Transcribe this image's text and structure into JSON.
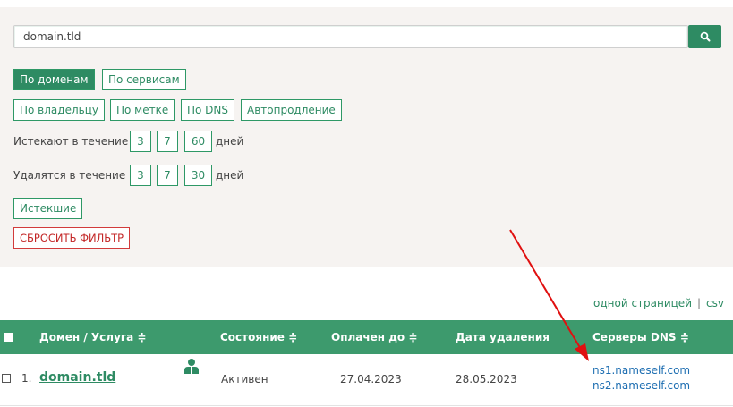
{
  "search": {
    "value": "domain.tld",
    "button_icon": "search-icon"
  },
  "filters": {
    "by_domains": "По доменам",
    "by_services": "По сервисам",
    "by_owner": "По владельцу",
    "by_tag": "По метке",
    "by_dns": "По DNS",
    "autorenew": "Автопродление",
    "expire_label": "Истекают в течение",
    "expire_options": [
      "3",
      "7",
      "60"
    ],
    "delete_label": "Удалятся в течение",
    "delete_options": [
      "3",
      "7",
      "30"
    ],
    "days_unit": "дней",
    "expired": "Истекшие",
    "reset": "СБРОСИТЬ ФИЛЬТР"
  },
  "view": {
    "one_page": "одной страницей",
    "separator": "|",
    "csv": "csv"
  },
  "table": {
    "headers": {
      "domain": "Домен / Услуга ≑",
      "status": "Состояние ≑",
      "paid_until": "Оплачен до ≑",
      "delete_date": "Дата удаления",
      "dns": "Серверы DNS ≑"
    },
    "rows": [
      {
        "num": "1.",
        "domain": "domain.tld",
        "owner_icon": "person-icon",
        "status": "Активен",
        "paid_until": "27.04.2023",
        "delete_date": "28.05.2023",
        "dns": [
          "ns1.nameself.com",
          "ns2.nameself.com"
        ]
      }
    ]
  },
  "colors": {
    "accent": "#2e8b63",
    "header": "#3d9a6d",
    "reset": "#c32626",
    "arrow": "#e01010"
  }
}
